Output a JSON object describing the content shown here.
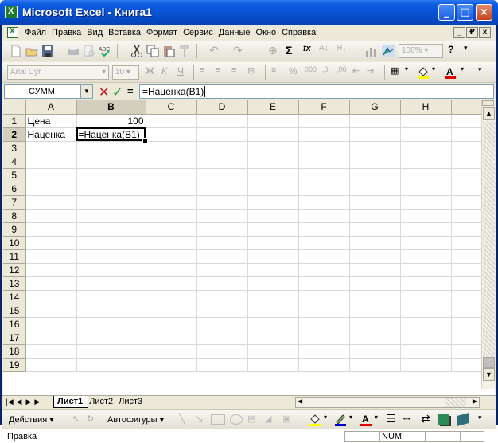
{
  "window": {
    "title": "Microsoft Excel - Книга1",
    "controls": [
      "_",
      "□",
      "×"
    ]
  },
  "menu": {
    "items": [
      "Файл",
      "Правка",
      "Вид",
      "Вставка",
      "Формат",
      "Сервис",
      "Данные",
      "Окно",
      "Справка"
    ],
    "doc_controls": [
      "_",
      "₽",
      "x"
    ]
  },
  "toolbar": {
    "zoom": "100%",
    "font_name": "Arial Cyr",
    "font_size": "10",
    "bold": "Ж",
    "italic": "К",
    "underline": "Ч",
    "sum": "Σ",
    "fx": "fx",
    "percent": "%",
    "thousands": "000"
  },
  "formula_bar": {
    "name_box": "СУММ",
    "cancel": "✕",
    "enter": "✓",
    "equals": "=",
    "formula": "=Наценка(B1)"
  },
  "grid": {
    "columns": [
      "A",
      "B",
      "C",
      "D",
      "E",
      "F",
      "G",
      "H"
    ],
    "rows": [
      "1",
      "2",
      "3",
      "4",
      "5",
      "6",
      "7",
      "8",
      "9",
      "10",
      "11",
      "12",
      "13",
      "14",
      "15",
      "16",
      "17",
      "18",
      "19"
    ],
    "cells": {
      "A1": "Цена",
      "B1": "100",
      "A2": "Наценка",
      "B2": "=Наценка(B1)"
    },
    "active_column": "B",
    "active_row": "2"
  },
  "sheets": {
    "tabs": [
      "Лист1",
      "Лист2",
      "Лист3"
    ],
    "active": "Лист1"
  },
  "draw_toolbar": {
    "actions": "Действия ▾",
    "autoshapes": "Автофигуры ▾"
  },
  "status": {
    "mode": "Правка",
    "num": "NUM"
  },
  "colors": {
    "title_bar": "#0a5ad6",
    "chrome": "#ece9d8",
    "cancel": "#c4161c",
    "enter": "#199a2f"
  }
}
